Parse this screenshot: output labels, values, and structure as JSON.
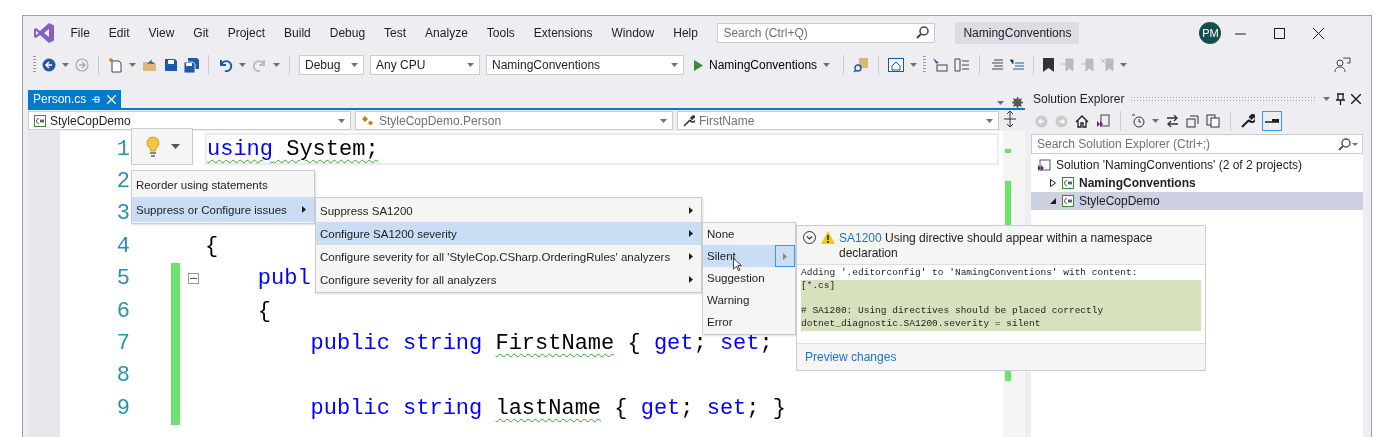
{
  "window": {
    "menu": [
      "File",
      "Edit",
      "View",
      "Git",
      "Project",
      "Build",
      "Debug",
      "Test",
      "Analyze",
      "Tools",
      "Extensions",
      "Window",
      "Help"
    ],
    "search": {
      "placeholder": "Search (Ctrl+Q)"
    },
    "title": "NamingConventions",
    "avatar": "PM"
  },
  "toolbar": {
    "configuration": "Debug",
    "platform": "Any CPU",
    "startup_project": "NamingConventions",
    "run_button": "NamingConventions"
  },
  "tabs": [
    {
      "label": "Person.cs",
      "selected": true
    }
  ],
  "navigation_bar": {
    "project": "StyleCopDemo",
    "type": "StyleCopDemo.Person",
    "member": "FirstName"
  },
  "editor": {
    "lines": [
      {
        "number": "1",
        "changed": false,
        "collapsible": false,
        "current": true,
        "tokens": [
          {
            "text": "using",
            "kind": "keyword",
            "squiggle": true
          },
          {
            "text": " System;",
            "kind": "plain",
            "squiggle": true
          }
        ]
      },
      {
        "number": "2",
        "changed": false,
        "collapsible": false,
        "current": false
      },
      {
        "number": "3",
        "changed": false,
        "collapsible": false,
        "current": false
      },
      {
        "number": "4",
        "changed": false,
        "collapsible": false,
        "current": false,
        "tokens": [
          {
            "text": "{",
            "kind": "plain",
            "squiggle": false
          }
        ]
      },
      {
        "number": "5",
        "changed": true,
        "collapsible": true,
        "current": false,
        "tokens": [
          {
            "text": "    publ",
            "kind": "keyword",
            "squiggle": false
          }
        ]
      },
      {
        "number": "6",
        "changed": true,
        "collapsible": false,
        "current": false,
        "tokens": [
          {
            "text": "    {",
            "kind": "plain",
            "squiggle": false
          }
        ]
      },
      {
        "number": "7",
        "changed": true,
        "collapsible": false,
        "current": false,
        "tokens": [
          {
            "text": "        public string ",
            "kind": "keyword",
            "squiggle": false
          },
          {
            "text": "FirstName",
            "kind": "plain",
            "squiggle": true
          },
          {
            "text": " { ",
            "kind": "plain",
            "squiggle": false
          },
          {
            "text": "get",
            "kind": "keyword",
            "squiggle": false
          },
          {
            "text": "; ",
            "kind": "plain",
            "squiggle": false
          },
          {
            "text": "set",
            "kind": "keyword",
            "squiggle": false
          },
          {
            "text": ";",
            "kind": "plain",
            "squiggle": false
          }
        ]
      },
      {
        "number": "8",
        "changed": true,
        "collapsible": false,
        "current": false
      },
      {
        "number": "9",
        "changed": true,
        "collapsible": false,
        "current": false,
        "tokens": [
          {
            "text": "        public string ",
            "kind": "keyword",
            "squiggle": false
          },
          {
            "text": "lastName",
            "kind": "plain",
            "squiggle": true
          },
          {
            "text": " { ",
            "kind": "plain",
            "squiggle": false
          },
          {
            "text": "get",
            "kind": "keyword",
            "squiggle": false
          },
          {
            "text": "; ",
            "kind": "plain",
            "squiggle": false
          },
          {
            "text": "set",
            "kind": "keyword",
            "squiggle": false
          },
          {
            "text": "; }",
            "kind": "plain",
            "squiggle": false
          }
        ]
      }
    ]
  },
  "quick_actions": {
    "menu": [
      {
        "label": "Reorder using statements",
        "selected": false,
        "submenu": false
      },
      {
        "label": "Suppress or Configure issues",
        "selected": true,
        "submenu": true
      }
    ],
    "submenu": [
      {
        "label": "Suppress SA1200",
        "selected": false,
        "submenu": true
      },
      {
        "label": "Configure SA1200 severity",
        "selected": true,
        "submenu": true
      },
      {
        "label": "Configure severity for all 'StyleCop.CSharp.OrderingRules' analyzers",
        "selected": false,
        "submenu": true
      },
      {
        "label": "Configure severity for all analyzers",
        "selected": false,
        "submenu": true
      }
    ],
    "severity_menu": [
      {
        "label": "None",
        "selected": false,
        "submenu": false
      },
      {
        "label": "Silent",
        "selected": true,
        "submenu": true
      },
      {
        "label": "Suggestion",
        "selected": false,
        "submenu": false
      },
      {
        "label": "Warning",
        "selected": false,
        "submenu": false
      },
      {
        "label": "Error",
        "selected": false,
        "submenu": false
      }
    ],
    "preview": {
      "code": "SA1200",
      "title": "Using directive should appear within a namespace declaration",
      "intro": "Adding '.editorconfig' to 'NamingConventions' with content:",
      "added_blocks": [
        [
          "[*.cs]"
        ],
        [
          "# SA1200: Using directives should be placed correctly",
          "dotnet_diagnostic.SA1200.severity = silent"
        ]
      ],
      "link": "Preview changes"
    }
  },
  "solution_explorer": {
    "title": "Solution Explorer",
    "search": {
      "placeholder": "Search Solution Explorer (Ctrl+;)"
    },
    "tree": [
      {
        "label": "Solution 'NamingConventions' (2 of 2 projects)",
        "kind": "solution",
        "startup": false,
        "selected": false,
        "children": [
          {
            "label": "NamingConventions",
            "kind": "project",
            "startup": true,
            "expanded": false,
            "selected": false
          },
          {
            "label": "StyleCopDemo",
            "kind": "project",
            "startup": false,
            "expanded": true,
            "selected": true
          }
        ]
      }
    ]
  }
}
